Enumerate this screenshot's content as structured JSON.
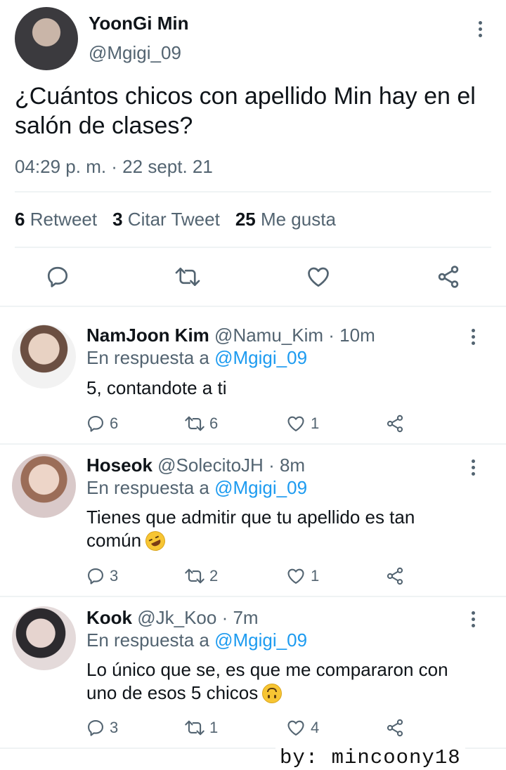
{
  "tweet": {
    "author_name": "YoonGi Min",
    "author_handle": "@Mgigi_09",
    "text_line1": "¿Cuántos chicos con apellido Min hay en el",
    "text_line2": "salón de clases?",
    "timestamp": "04:29 p. m. · 22 sept. 21",
    "stats": {
      "retweets_count": "6",
      "retweets_label": "Retweet",
      "quotes_count": "3",
      "quotes_label": "Citar Tweet",
      "likes_count": "25",
      "likes_label": "Me gusta"
    }
  },
  "reply_to_label": "En respuesta a",
  "replies": [
    {
      "name": "NamJoon Kim",
      "handle": "@Namu_Kim",
      "time": "· 10m",
      "reply_to": "@Mgigi_09",
      "text_line1": "5, contandote a ti",
      "text_line2": "",
      "replies_count": "6",
      "retweets_count": "6",
      "likes_count": "1"
    },
    {
      "name": "Hoseok",
      "handle": "@SolecitoJH",
      "time": "· 8m",
      "reply_to": "@Mgigi_09",
      "text_line1": "Tienes que admitir que tu apellido es tan",
      "text_line2": "común",
      "replies_count": "3",
      "retweets_count": "2",
      "likes_count": "1"
    },
    {
      "name": "Kook",
      "handle": "@Jk_Koo",
      "time": "· 7m",
      "reply_to": "@Mgigi_09",
      "text_line1": "Lo único que se, es que me compararon con",
      "text_line2": "uno de esos 5 chicos",
      "replies_count": "3",
      "retweets_count": "1",
      "likes_count": "4"
    }
  ],
  "watermark": "by: mincoony18",
  "colors": {
    "text": "#0f1419",
    "secondary": "#536471",
    "link": "#1d9bf0",
    "divider": "#eff3f4"
  }
}
